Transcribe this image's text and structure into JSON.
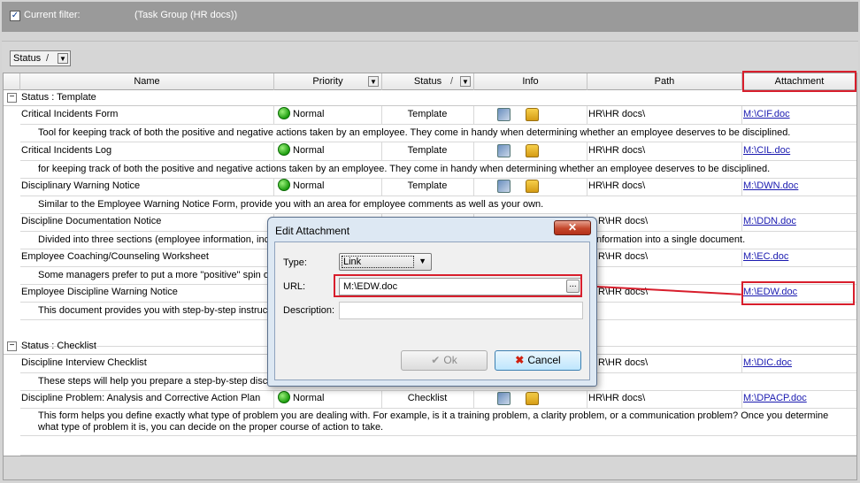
{
  "filter": {
    "checked": true,
    "label": "Current filter:",
    "value": "(Task Group  (HR docs))"
  },
  "groupby": {
    "label": "Status",
    "sort_glyph": "/",
    "dropdown_glyph": "▼"
  },
  "columns": {
    "name": "Name",
    "priority": "Priority",
    "status": "Status",
    "status_sort": "/",
    "info": "Info",
    "path": "Path",
    "attachment": "Attachment",
    "dropdown_glyph": "▼"
  },
  "groups": [
    {
      "toggle": "−",
      "title": "Status : Template",
      "tasks": [
        {
          "name": "Critical Incidents Form",
          "priority": "Normal",
          "status": "Template",
          "path": "HR\\HR docs\\",
          "attachment": "M:\\CIF.doc",
          "description": "Tool for keeping track of both the positive and negative actions taken by an employee. They come in handy when determining whether an employee deserves to be disciplined."
        },
        {
          "name": "Critical Incidents Log",
          "priority": "Normal",
          "status": "Template",
          "path": "HR\\HR docs\\",
          "attachment": "M:\\CIL.doc",
          "description": "for keeping track of both the positive and negative actions taken by an employee. They come in handy when determining whether an employee deserves to be disciplined."
        },
        {
          "name": "Disciplinary Warning Notice",
          "priority": "Normal",
          "status": "Template",
          "path": "HR\\HR docs\\",
          "attachment": "M:\\DWN.doc",
          "description": "Similar to the Employee Warning Notice Form, provide you with an area for employee comments as well as your own."
        },
        {
          "name": "Discipline Documentation Notice",
          "priority": "",
          "status": "",
          "path": "R\\HR docs\\",
          "attachment": "M:\\DDN.doc",
          "description": "Divided into three sections (employee information, incid",
          "description_tail": "nformation into a single document."
        },
        {
          "name": "Employee Coaching/Counseling Worksheet",
          "priority": "",
          "status": "",
          "path": "R\\HR docs\\",
          "attachment": "M:\\EC.doc",
          "description": "Some managers prefer to put a more \"positive\" spin on"
        },
        {
          "name": "Employee Discipline Warning Notice",
          "priority": "",
          "status": "",
          "path": "R\\HR docs\\",
          "attachment": "M:\\EDW.doc",
          "description": "This document provides you with step-by-step instructio"
        }
      ]
    },
    {
      "toggle": "−",
      "title": "Status : Checklist",
      "tasks": [
        {
          "name": "Discipline Interview Checklist",
          "priority": "",
          "status": "",
          "path": "R\\HR docs\\",
          "attachment": "M:\\DIC.doc",
          "description": "These steps will help you prepare a step-by-step discipli"
        },
        {
          "name": "Discipline Problem: Analysis and Corrective Action Plan",
          "priority": "Normal",
          "status": "Checklist",
          "path": "HR\\HR docs\\",
          "attachment": "M:\\DPACP.doc",
          "description": "This form helps you define exactly what type of problem you are dealing with. For example, is it a training problem, a clarity problem, or a communication problem? Once you determine what type of problem it is, you can decide on the proper course of action to take."
        }
      ]
    }
  ],
  "dialog": {
    "title": "Edit Attachment",
    "close": "✕",
    "type_label": "Type:",
    "type_value": "Link",
    "url_label": "URL:",
    "url_value": "M:\\EDW.doc",
    "browse": "...",
    "description_label": "Description:",
    "description_value": "",
    "ok_label": "Ok",
    "cancel_label": "Cancel"
  },
  "colors": {
    "highlight": "#d81e2c",
    "link": "#1a1ab0",
    "priority_normal": "#1e9e10"
  },
  "icons": {
    "info_1": "task-properties-icon",
    "info_2": "lock-icon"
  }
}
